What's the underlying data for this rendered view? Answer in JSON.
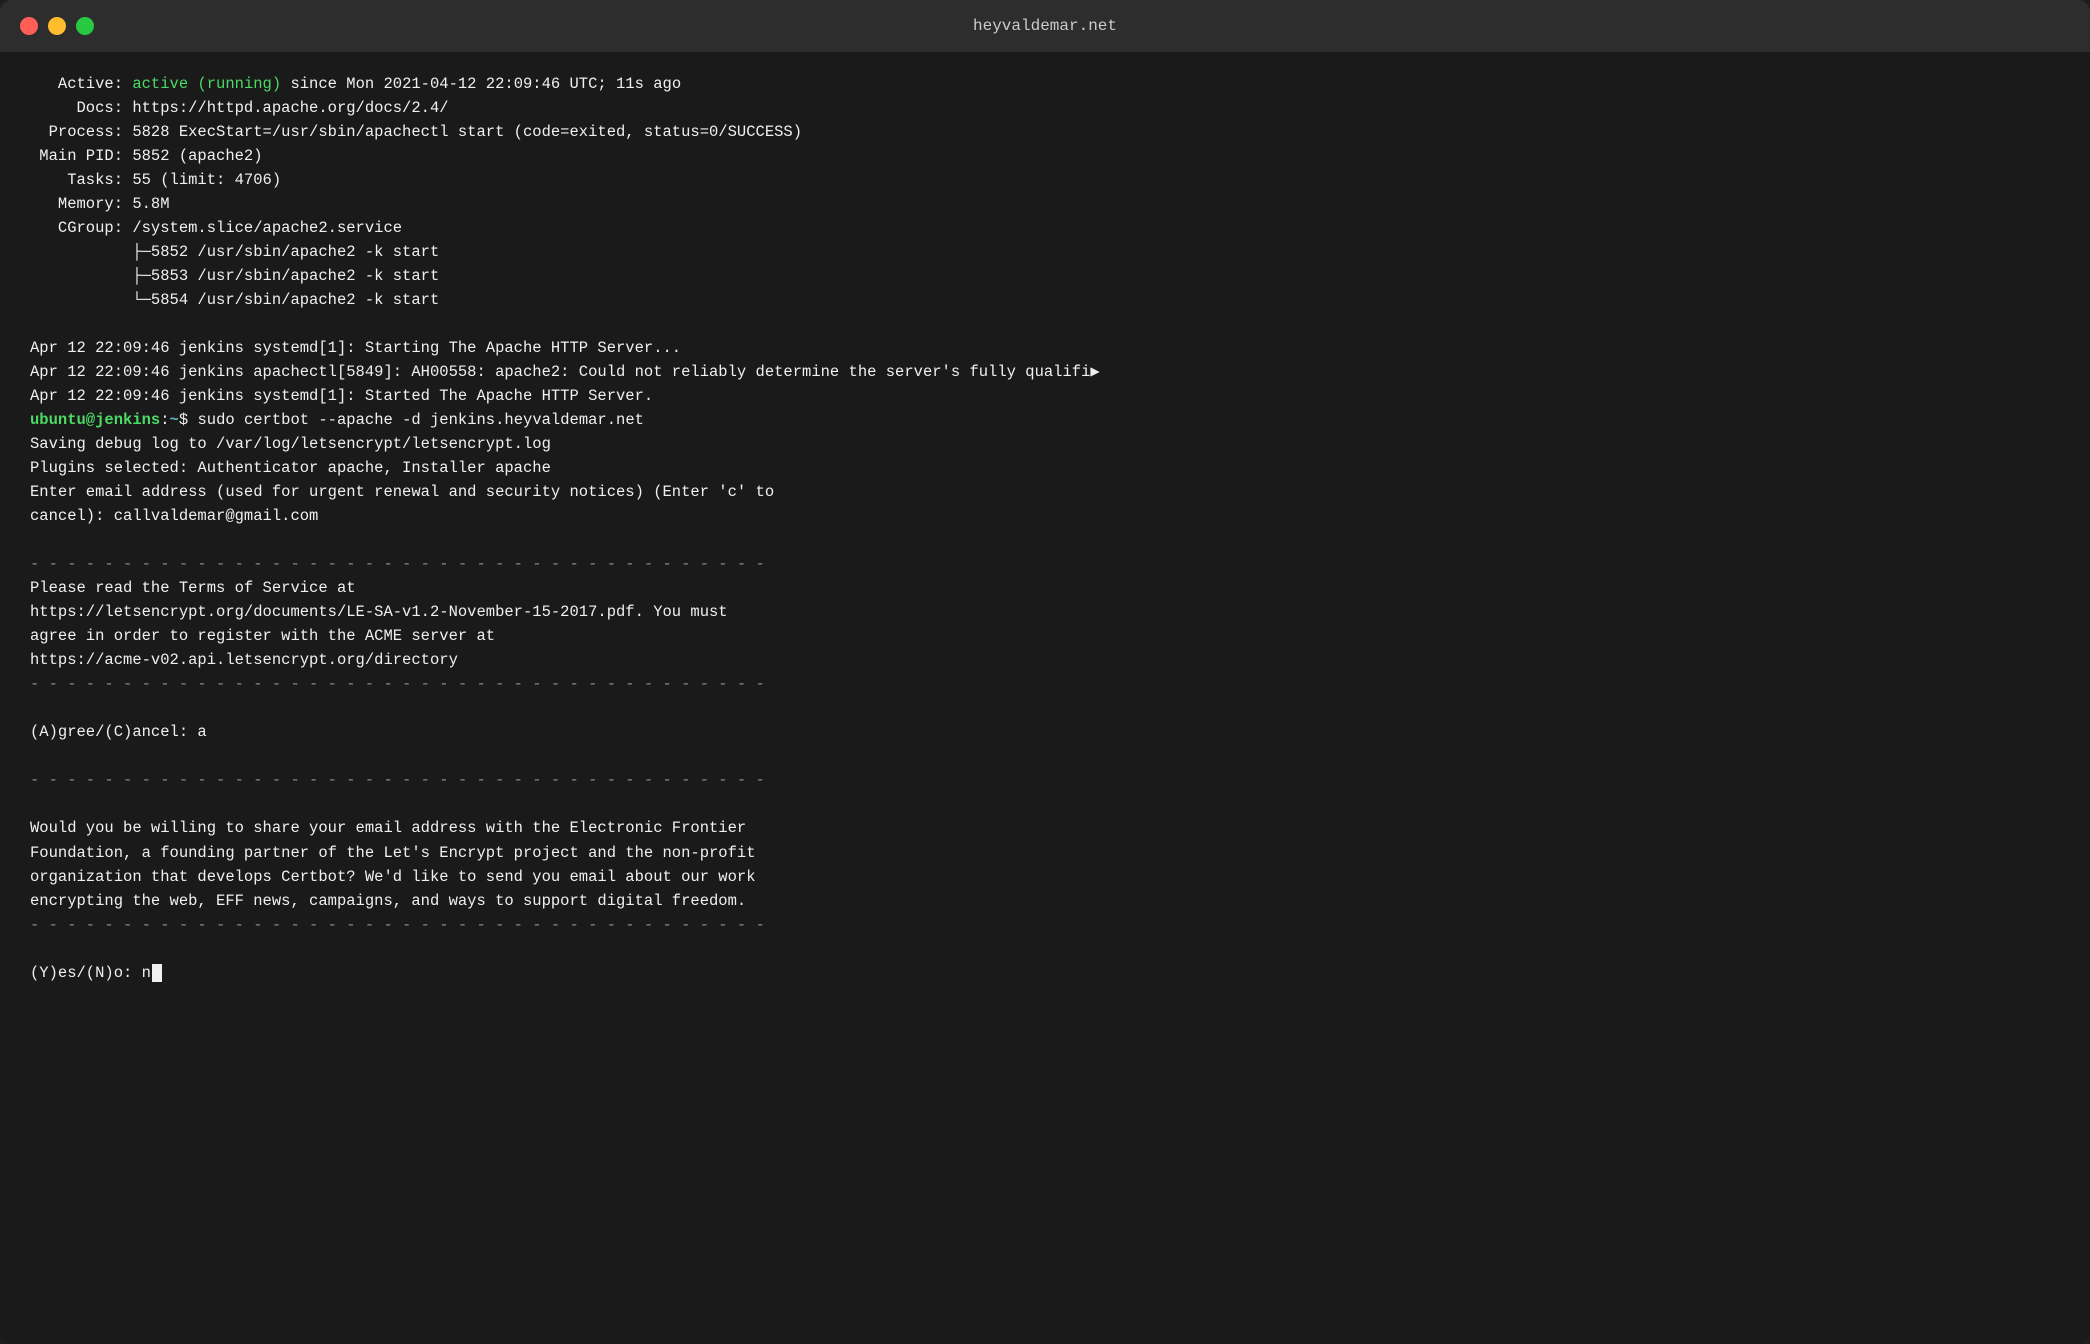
{
  "window": {
    "title": "heyvaldemar.net",
    "traffic_lights": {
      "close": "close",
      "minimize": "minimize",
      "maximize": "maximize"
    }
  },
  "terminal": {
    "lines": [
      {
        "type": "status",
        "text": "   Active: ",
        "highlight": "active (running)",
        "rest": " since Mon 2021-04-12 22:09:46 UTC; 11s ago"
      },
      {
        "type": "plain",
        "text": "     Docs: https://httpd.apache.org/docs/2.4/"
      },
      {
        "type": "plain",
        "text": "  Process: 5828 ExecStart=/usr/sbin/apachectl start (code=exited, status=0/SUCCESS)"
      },
      {
        "type": "plain",
        "text": " Main PID: 5852 (apache2)"
      },
      {
        "type": "plain",
        "text": "    Tasks: 55 (limit: 4706)"
      },
      {
        "type": "plain",
        "text": "   Memory: 5.8M"
      },
      {
        "type": "plain",
        "text": "   CGroup: /system.slice/apache2.service"
      },
      {
        "type": "plain",
        "text": "           ├─5852 /usr/sbin/apache2 -k start"
      },
      {
        "type": "plain",
        "text": "           ├─5853 /usr/sbin/apache2 -k start"
      },
      {
        "type": "plain",
        "text": "           └─5854 /usr/sbin/apache2 -k start"
      },
      {
        "type": "blank"
      },
      {
        "type": "plain",
        "text": "Apr 12 22:09:46 jenkins systemd[1]: Starting The Apache HTTP Server..."
      },
      {
        "type": "plain_overflow",
        "text": "Apr 12 22:09:46 jenkins apachectl[5849]: AH00558: apache2: Could not reliably determine the server's fully qualifi▶"
      },
      {
        "type": "plain",
        "text": "Apr 12 22:09:46 jenkins systemd[1]: Started The Apache HTTP Server."
      },
      {
        "type": "prompt",
        "user": "ubuntu@jenkins",
        "path": ":~",
        "symbol": "$",
        "command": " sudo certbot --apache -d jenkins.heyvaldemar.net"
      },
      {
        "type": "plain",
        "text": "Saving debug log to /var/log/letsencrypt/letsencrypt.log"
      },
      {
        "type": "plain",
        "text": "Plugins selected: Authenticator apache, Installer apache"
      },
      {
        "type": "plain",
        "text": "Enter email address (used for urgent renewal and security notices) (Enter 'c' to"
      },
      {
        "type": "plain",
        "text": "cancel): callvaldemar@gmail.com"
      },
      {
        "type": "blank"
      },
      {
        "type": "separator",
        "text": "- - - - - - - - - - - - - - - - - - - - - - - - - - - - - - - - - - - - - - - -"
      },
      {
        "type": "plain",
        "text": "Please read the Terms of Service at"
      },
      {
        "type": "plain",
        "text": "https://letsencrypt.org/documents/LE-SA-v1.2-November-15-2017.pdf. You must"
      },
      {
        "type": "plain",
        "text": "agree in order to register with the ACME server at"
      },
      {
        "type": "plain",
        "text": "https://acme-v02.api.letsencrypt.org/directory"
      },
      {
        "type": "separator",
        "text": "- - - - - - - - - - - - - - - - - - - - - - - - - - - - - - - - - - - - - - - -"
      },
      {
        "type": "blank"
      },
      {
        "type": "plain",
        "text": "(A)gree/(C)ancel: a"
      },
      {
        "type": "blank"
      },
      {
        "type": "separator",
        "text": "- - - - - - - - - - - - - - - - - - - - - - - - - - - - - - - - - - - - - - - -"
      },
      {
        "type": "blank"
      },
      {
        "type": "plain",
        "text": "Would you be willing to share your email address with the Electronic Frontier"
      },
      {
        "type": "plain",
        "text": "Foundation, a founding partner of the Let's Encrypt project and the non-profit"
      },
      {
        "type": "plain",
        "text": "organization that develops Certbot? We'd like to send you email about our work"
      },
      {
        "type": "plain",
        "text": "encrypting the web, EFF news, campaigns, and ways to support digital freedom."
      },
      {
        "type": "separator",
        "text": "- - - - - - - - - - - - - - - - - - - - - - - - - - - - - - - - - - - - - - - -"
      },
      {
        "type": "blank"
      },
      {
        "type": "input_line",
        "text": "(Y)es/(N)o: n",
        "has_cursor": true
      }
    ]
  }
}
